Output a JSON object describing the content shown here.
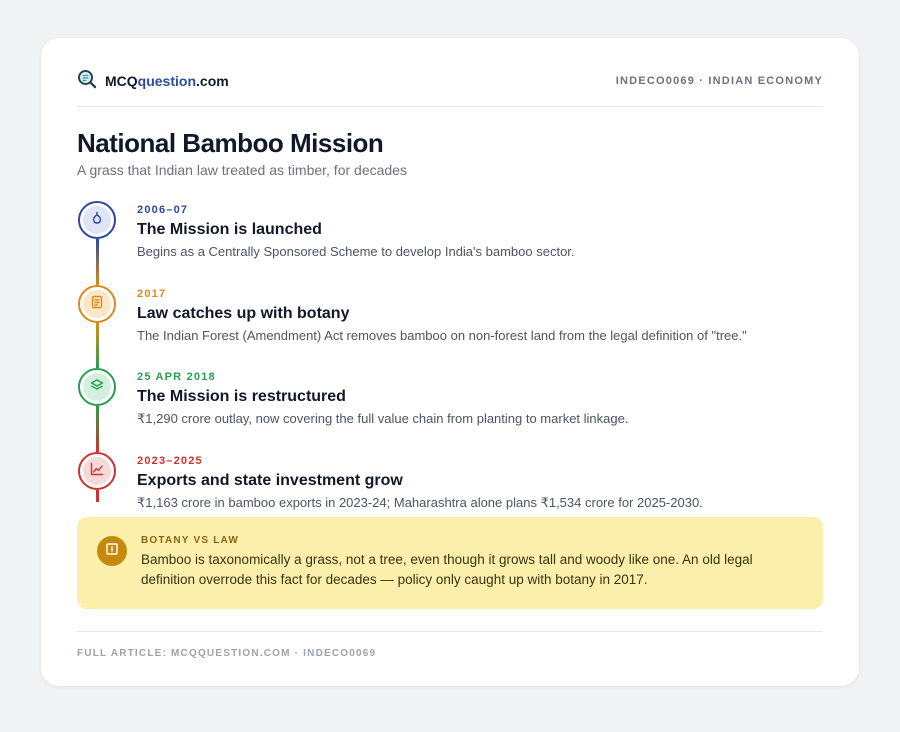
{
  "header": {
    "brand_prefix": "MCQ",
    "brand_highlight": "question",
    "brand_suffix": ".com",
    "tag": "INDECO0069 · INDIAN ECONOMY"
  },
  "title": "National Bamboo Mission",
  "subtitle": "A grass that Indian law treated as timber, for decades",
  "timeline": [
    {
      "date": "2006–07",
      "title": "The Mission is launched",
      "description": "Begins as a Centrally Sponsored Scheme to develop India's bamboo sector.",
      "color": "#2d4a9e",
      "icon": "bamboo-shoot-icon"
    },
    {
      "date": "2017",
      "title": "Law catches up with botany",
      "description": "The Indian Forest (Amendment) Act removes bamboo on non-forest land from the legal definition of \"tree.\"",
      "color": "#d98a1c",
      "icon": "document-icon"
    },
    {
      "date": "25 APR 2018",
      "title": "The Mission is restructured",
      "description": "₹1,290 crore outlay, now covering the full value chain from planting to market linkage.",
      "color": "#2a9d4f",
      "icon": "layers-icon"
    },
    {
      "date": "2023–2025",
      "title": "Exports and state investment grow",
      "description": "₹1,163 crore in bamboo exports in 2023-24; Maharashtra alone plans ₹1,534 crore for 2025-2030.",
      "color": "#d0312d",
      "icon": "chart-icon"
    }
  ],
  "callout": {
    "label": "BOTANY VS LAW",
    "text": "Bamboo is taxonomically a grass, not a tree, even though it grows tall and woody like one. An old legal definition overrode this fact for decades — policy only caught up with botany in 2017.",
    "icon": "book-icon"
  },
  "footer": "FULL ARTICLE: MCQQUESTION.COM · INDECO0069"
}
